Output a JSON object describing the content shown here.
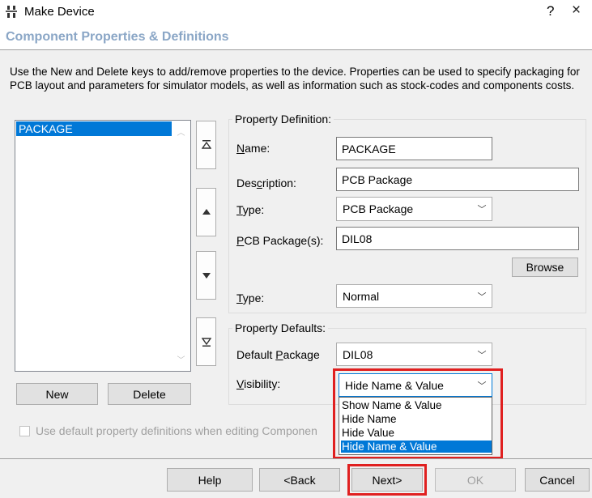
{
  "window": {
    "title": "Make Device",
    "help": "?",
    "close": "×"
  },
  "header": {
    "title": "Component Properties & Definitions"
  },
  "description": "Use the New and Delete keys to add/remove properties to the device. Properties can be used to specify packaging for PCB layout and parameters for simulator models, as well as information such as stock-codes and components costs.",
  "property_list": {
    "items": [
      "PACKAGE"
    ],
    "selected": 0
  },
  "list_buttons": {
    "new": "New",
    "delete": "Delete"
  },
  "move_buttons": [
    "move-to-top",
    "move-up",
    "move-down",
    "move-to-bottom"
  ],
  "property_definition": {
    "group_label": "Property Definition:",
    "name_label": "Name:",
    "name_label_u": "N",
    "name_label_rest": "ame:",
    "name_value": "PACKAGE",
    "description_label_pre": "Des",
    "description_label_u": "c",
    "description_label_rest": "ription:",
    "description_value": "PCB Package",
    "type_label_u": "T",
    "type_label_rest": "ype:",
    "type_value": "PCB Package",
    "pcb_label_u": "P",
    "pcb_label_rest": "CB Package(s):",
    "pcb_value": "DIL08",
    "browse": "Browse",
    "type2_label_u": "T",
    "type2_label_rest": "ype:",
    "type2_value": "Normal"
  },
  "property_defaults": {
    "group_label": "Property Defaults:",
    "default_pkg_pre": "Default ",
    "default_pkg_u": "P",
    "default_pkg_rest": "ackage",
    "default_pkg_value": "DIL08",
    "visibility_u": "V",
    "visibility_rest": "isibility:",
    "visibility_value": "Hide Name & Value",
    "visibility_options": [
      "Show Name & Value",
      "Hide Name",
      "Hide Value",
      "Hide Name & Value"
    ],
    "visibility_selected": 3
  },
  "checkbox": {
    "label": "Use default property definitions when editing Componen",
    "checked": false
  },
  "footer": {
    "help": "Help",
    "back": "<Back",
    "next": "Next>",
    "ok": "OK",
    "cancel": "Cancel"
  },
  "colors": {
    "selection": "#0078d7",
    "highlight_box": "#e02020",
    "header_text": "#8aa6c6"
  }
}
